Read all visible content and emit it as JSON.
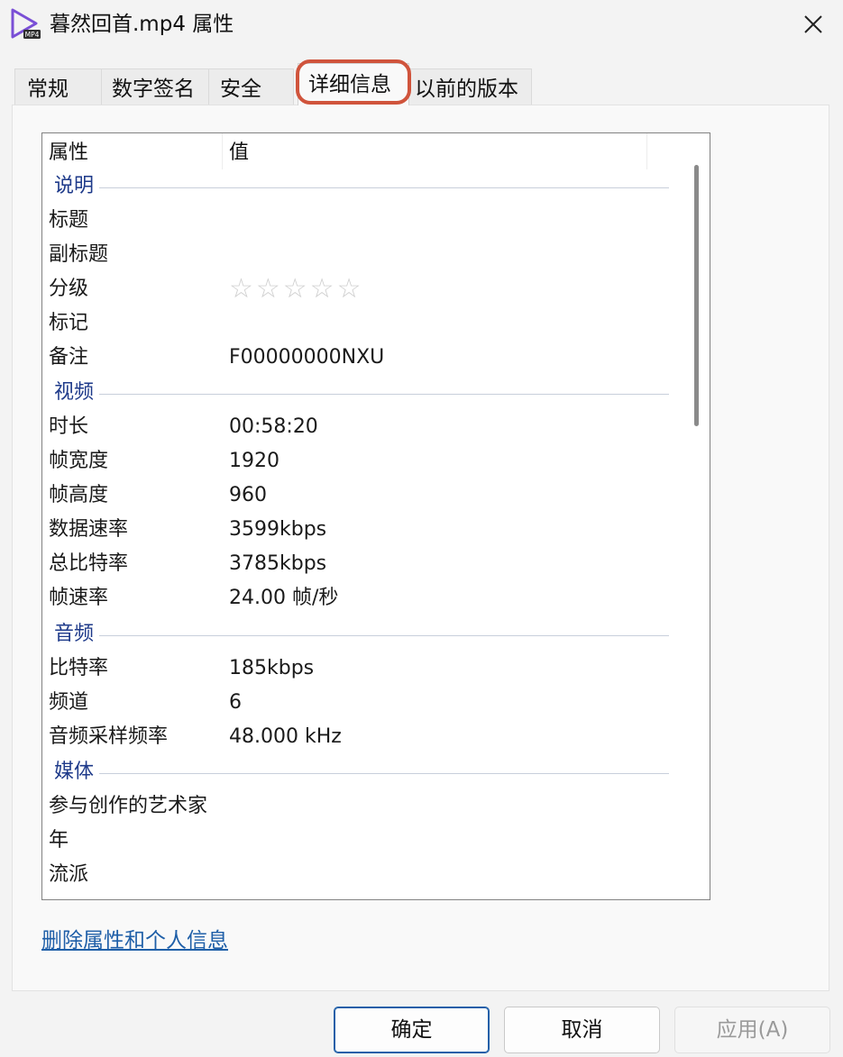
{
  "window": {
    "title": "暮然回首.mp4 属性",
    "app_icon": "play-triangle-icon",
    "app_icon_badge": "MP4",
    "close_icon": "close-icon"
  },
  "tabs": [
    {
      "label": "常规",
      "active": false
    },
    {
      "label": "数字签名",
      "active": false
    },
    {
      "label": "安全",
      "active": false
    },
    {
      "label": "详细信息",
      "active": true
    },
    {
      "label": "以前的版本",
      "active": false
    }
  ],
  "details": {
    "columns": {
      "property": "属性",
      "value": "值"
    },
    "groups": {
      "description": "说明",
      "video": "视频",
      "audio": "音频",
      "media": "媒体"
    },
    "rows": {
      "title": {
        "k": "标题",
        "v": ""
      },
      "subtitle": {
        "k": "副标题",
        "v": ""
      },
      "rating": {
        "k": "分级",
        "stars": 0,
        "max_stars": 5,
        "glyphs": "☆☆☆☆☆"
      },
      "tags": {
        "k": "标记",
        "v": ""
      },
      "comments": {
        "k": "备注",
        "v": "F00000000NXU"
      },
      "length": {
        "k": "时长",
        "v": "00:58:20"
      },
      "frame_width": {
        "k": "帧宽度",
        "v": "1920"
      },
      "frame_height": {
        "k": "帧高度",
        "v": "960"
      },
      "data_rate": {
        "k": "数据速率",
        "v": "3599kbps"
      },
      "total_bitrate": {
        "k": "总比特率",
        "v": "3785kbps"
      },
      "frame_rate": {
        "k": "帧速率",
        "v": "24.00 帧/秒"
      },
      "audio_bitrate": {
        "k": "比特率",
        "v": "185kbps"
      },
      "channels": {
        "k": "频道",
        "v": "6"
      },
      "sample_rate": {
        "k": "音频采样频率",
        "v": "48.000 kHz"
      },
      "contributing_artists": {
        "k": "参与创作的艺术家",
        "v": ""
      },
      "year": {
        "k": "年",
        "v": ""
      },
      "genre": {
        "k": "流派",
        "v": ""
      }
    }
  },
  "remove_link": "删除属性和个人信息",
  "buttons": {
    "ok": "确定",
    "cancel": "取消",
    "apply": "应用(A)"
  },
  "colors": {
    "accent": "#1f5fa8",
    "group_header": "#1e3a8a",
    "highlight_ring": "#d0543c"
  }
}
